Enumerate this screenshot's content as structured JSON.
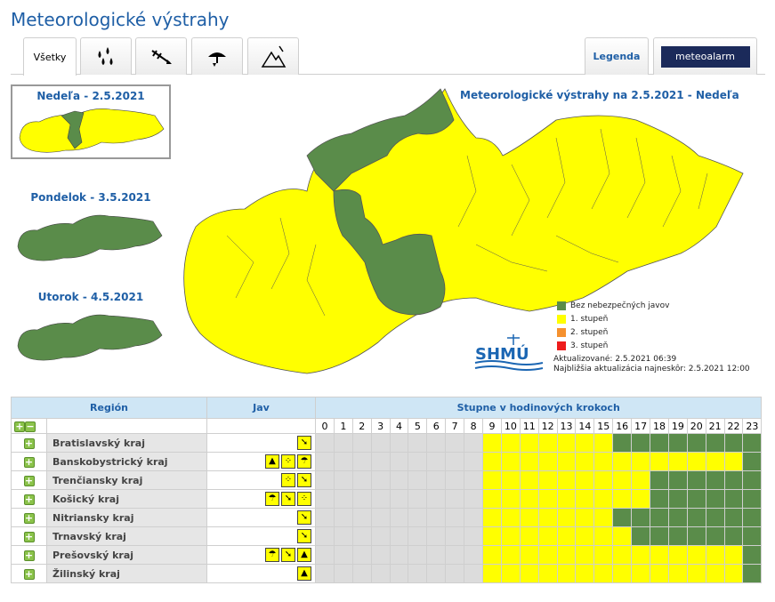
{
  "title": "Meteorologické výstrahy",
  "tabs": [
    {
      "label": "Všetky",
      "icon": "all"
    },
    {
      "label": "",
      "icon": "rain-icon"
    },
    {
      "label": "",
      "icon": "wind-icon"
    },
    {
      "label": "",
      "icon": "storm-icon"
    },
    {
      "label": "",
      "icon": "mountain-icon"
    }
  ],
  "legend_tab": "Legenda",
  "meteoalarm": "meteoalarm",
  "days": [
    {
      "label": "Nedeľa - 2.5.2021",
      "selected": true
    },
    {
      "label": "Pondelok - 3.5.2021",
      "selected": false
    },
    {
      "label": "Utorok - 4.5.2021",
      "selected": false
    }
  ],
  "map_title": "Meteorologické výstrahy na 2.5.2021 - Nedeľa",
  "legend": [
    {
      "label": "Bez nebezpečných javov",
      "color": "#5a8c4a"
    },
    {
      "label": "1. stupeň",
      "color": "#ffff00"
    },
    {
      "label": "2. stupeň",
      "color": "#f5912f"
    },
    {
      "label": "3. stupeň",
      "color": "#ee1c1c"
    }
  ],
  "logo_text": "SHMÚ",
  "update_text": "Aktualizované: 2.5.2021 06:39",
  "next_update_text": "Najbližšia aktualizácia najneskôr: 2.5.2021 12:00",
  "table": {
    "header_region": "Región",
    "header_jav": "Jav",
    "header_steps": "Stupne v hodinových krokoch",
    "hours": [
      "0",
      "1",
      "2",
      "3",
      "4",
      "5",
      "6",
      "7",
      "8",
      "9",
      "10",
      "11",
      "12",
      "13",
      "14",
      "15",
      "16",
      "17",
      "18",
      "19",
      "20",
      "21",
      "22",
      "23"
    ],
    "regions": [
      {
        "name": "Bratislavský kraj",
        "icons": [
          "wind"
        ],
        "steps": "GGGGGGGGGYYYYYYYVVVVVVVV"
      },
      {
        "name": "Banskobystrický kraj",
        "icons": [
          "mountain",
          "rain",
          "storm"
        ],
        "steps": "GGGGGGGGGYYYYYYYYYYYYYYV"
      },
      {
        "name": "Trenčiansky kraj",
        "icons": [
          "rain",
          "wind"
        ],
        "steps": "GGGGGGGGGYYYYYYYYYVVVVVV"
      },
      {
        "name": "Košický kraj",
        "icons": [
          "storm",
          "wind",
          "rain"
        ],
        "steps": "GGGGGGGGGYYYYYYYYYVVVVVV"
      },
      {
        "name": "Nitriansky kraj",
        "icons": [
          "wind"
        ],
        "steps": "GGGGGGGGGYYYYYYYVVVVVVVV"
      },
      {
        "name": "Trnavský kraj",
        "icons": [
          "wind"
        ],
        "steps": "GGGGGGGGGYYYYYYYYVVVVVVV"
      },
      {
        "name": "Prešovský kraj",
        "icons": [
          "storm",
          "wind",
          "mountain"
        ],
        "steps": "GGGGGGGGGYYYYYYYYYYYYYYV"
      },
      {
        "name": "Žilinský kraj",
        "icons": [
          "mountain"
        ],
        "steps": "GGGGGGGGGYYYYYYYYYYYYYYV"
      }
    ]
  }
}
